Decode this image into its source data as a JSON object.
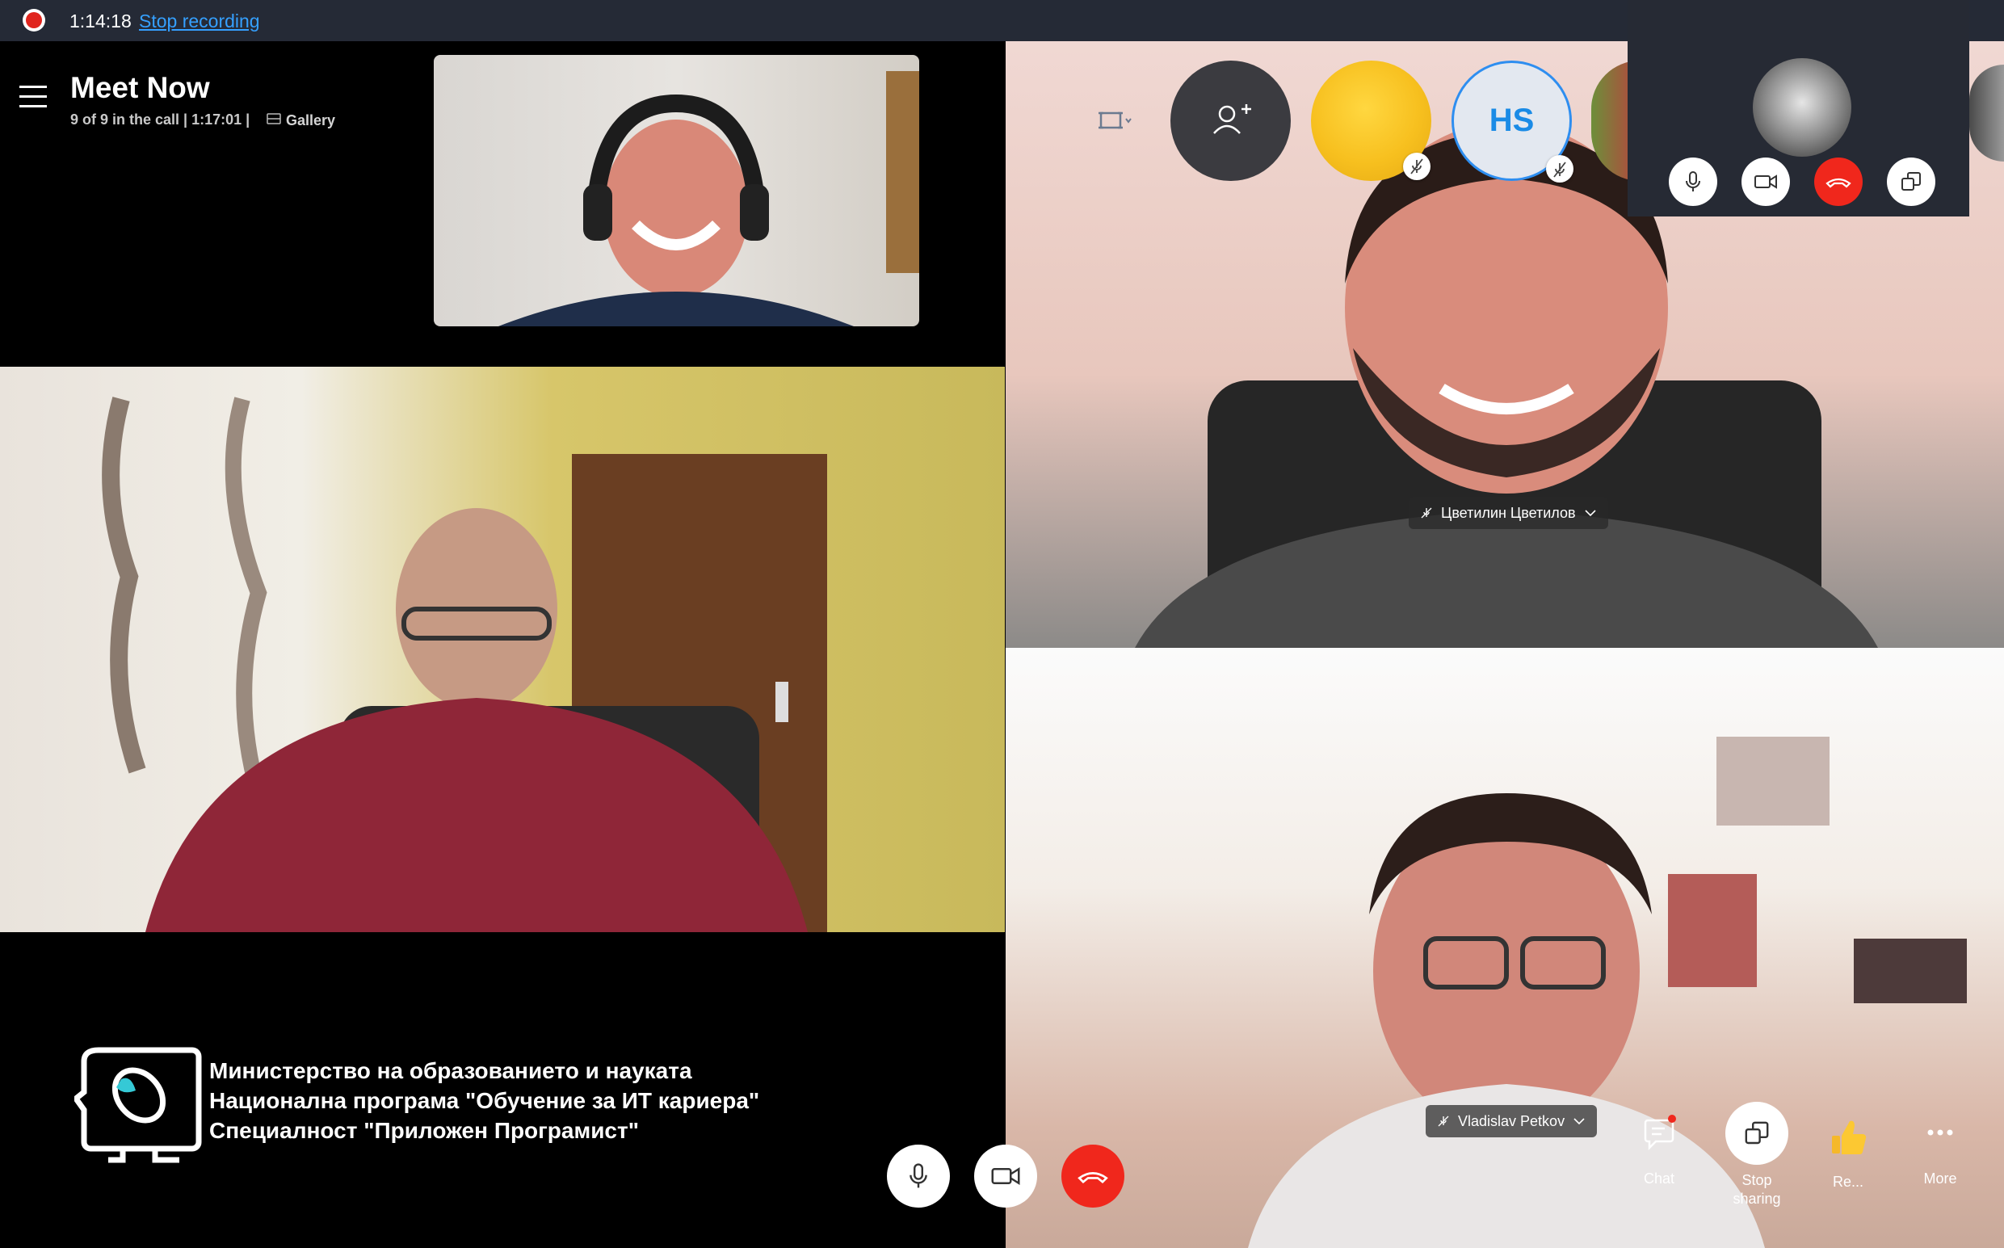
{
  "recording": {
    "time": "1:14:18",
    "stop_label": "Stop recording"
  },
  "header": {
    "title": "Meet Now",
    "subtitle": "9 of 9 in the call | 1:17:01  |",
    "view_label": "Gallery"
  },
  "participants": {
    "top_right_name": "Цветилин Цветилов",
    "bottom_right_name": "Vladislav Petkov",
    "avatar_initials": "HS"
  },
  "watermark": {
    "line1": "Министерство на образованието и науката",
    "line2": "Национална програма \"Обучение за ИТ кариера\"",
    "line3": "Специалност \"Приложен Програмист\""
  },
  "toolbar": {
    "chat_label": "Chat",
    "stop_sharing_line1": "Stop",
    "stop_sharing_line2": "sharing",
    "react_label": "Re...",
    "more_label": "More"
  },
  "icons": {
    "record": "record-dot-icon",
    "menu": "hamburger-icon",
    "gallery": "gallery-icon",
    "layout": "layout-icon",
    "add_people": "add-person-icon",
    "mic": "microphone-icon",
    "camera": "camera-icon",
    "hangup": "hangup-icon",
    "share": "share-screen-icon",
    "chat": "chat-icon",
    "react": "thumbs-up-icon",
    "more": "more-icon",
    "muted": "mic-off-icon"
  },
  "colors": {
    "hangup_red": "#f0271c",
    "link_blue": "#35a0ff",
    "accent_blue": "#2e8ef0",
    "panel_bg": "#262a34"
  }
}
